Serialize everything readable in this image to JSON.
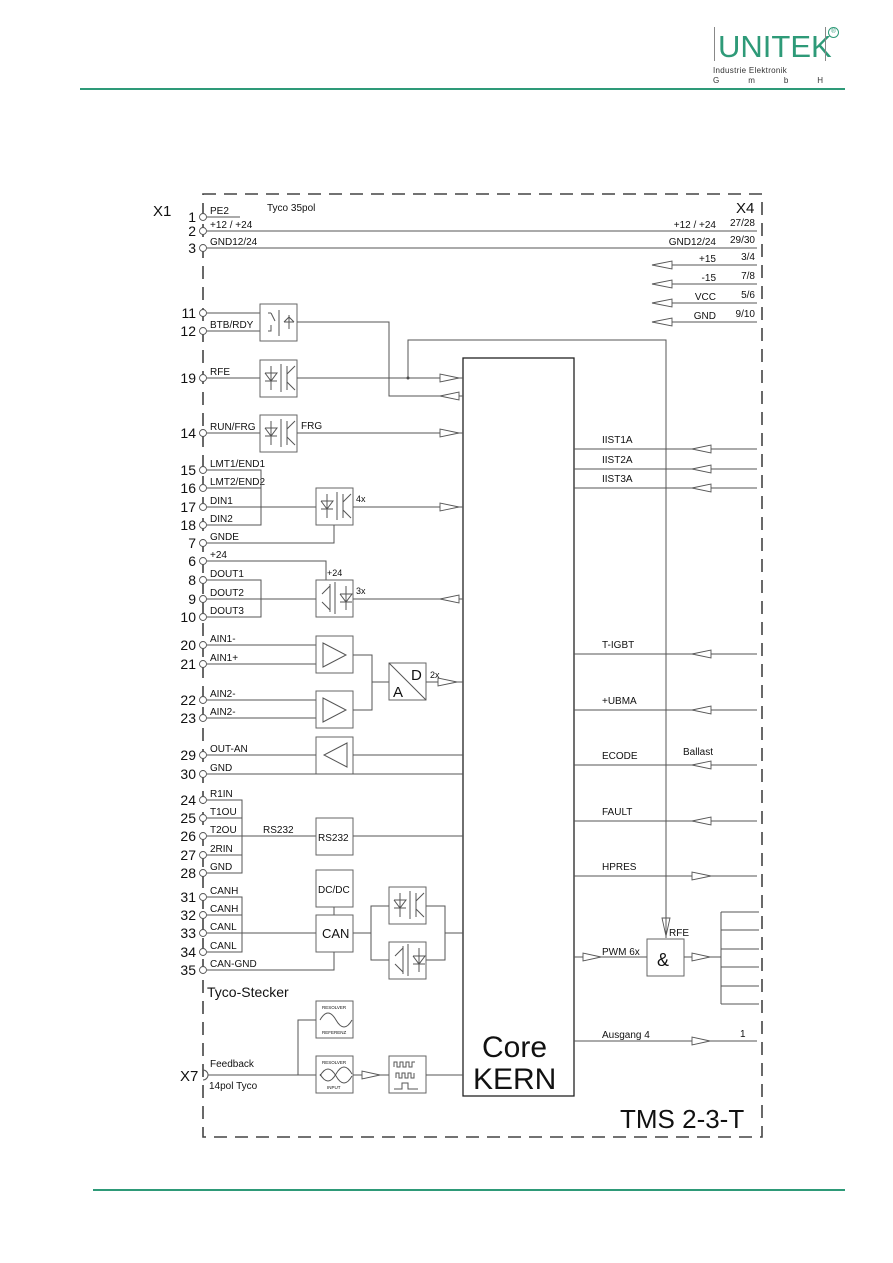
{
  "header": {
    "logo": {
      "brand": "UNITEK",
      "subtitle": "Industrie Elektronik",
      "gmbh": [
        "G",
        "m",
        "b",
        "H"
      ],
      "registered_mark": "®"
    }
  },
  "colors": {
    "accent": "#2e9a78",
    "line": "#555555"
  },
  "diagram": {
    "title": "TMS 2-3-T",
    "core_label_line1": "Core",
    "core_label_line2": "KERN",
    "x1_label": "X1",
    "x4_label": "X4",
    "x7_label": "X7",
    "connector_note": "Tyco 35pol",
    "tyco_stecker": "Tyco-Stecker",
    "feedback_label": "Feedback",
    "feedback_connector": "14pol Tyco",
    "x1_pins": [
      {
        "pin": "1",
        "signal": "PE2"
      },
      {
        "pin": "2",
        "signal": "+12 / +24"
      },
      {
        "pin": "3",
        "signal": "GND12/24"
      },
      {
        "pin": "11",
        "signal": ""
      },
      {
        "pin": "12",
        "signal": "BTB/RDY"
      },
      {
        "pin": "19",
        "signal": "RFE"
      },
      {
        "pin": "14",
        "signal": "RUN/FRG"
      },
      {
        "pin": "15",
        "signal": "LMT1/END1"
      },
      {
        "pin": "16",
        "signal": "LMT2/END2"
      },
      {
        "pin": "17",
        "signal": "DIN1"
      },
      {
        "pin": "18",
        "signal": "DIN2"
      },
      {
        "pin": "7",
        "signal": "GNDE"
      },
      {
        "pin": "6",
        "signal": "+24"
      },
      {
        "pin": "8",
        "signal": "DOUT1"
      },
      {
        "pin": "9",
        "signal": "DOUT2"
      },
      {
        "pin": "10",
        "signal": "DOUT3"
      },
      {
        "pin": "20",
        "signal": "AIN1-"
      },
      {
        "pin": "21",
        "signal": "AIN1+"
      },
      {
        "pin": "22",
        "signal": "AIN2-"
      },
      {
        "pin": "23",
        "signal": "AIN2-"
      },
      {
        "pin": "29",
        "signal": "OUT-AN"
      },
      {
        "pin": "30",
        "signal": "GND"
      },
      {
        "pin": "24",
        "signal": "R1IN"
      },
      {
        "pin": "25",
        "signal": "T1OU"
      },
      {
        "pin": "26",
        "signal": "T2OU"
      },
      {
        "pin": "27",
        "signal": "2RIN"
      },
      {
        "pin": "28",
        "signal": "GND"
      },
      {
        "pin": "31",
        "signal": "CANH"
      },
      {
        "pin": "32",
        "signal": "CANH"
      },
      {
        "pin": "33",
        "signal": "CANL"
      },
      {
        "pin": "34",
        "signal": "CANL"
      },
      {
        "pin": "35",
        "signal": "CAN-GND"
      }
    ],
    "x4_pins": [
      {
        "signal": "+12 / +24",
        "pins": "27/28"
      },
      {
        "signal": "GND12/24",
        "pins": "29/30"
      },
      {
        "signal": "+15",
        "pins": "3/4"
      },
      {
        "signal": "-15",
        "pins": "7/8"
      },
      {
        "signal": "VCC",
        "pins": "5/6"
      },
      {
        "signal": "GND",
        "pins": "9/10"
      }
    ],
    "labels": {
      "frg": "FRG",
      "din_mult": "4x",
      "plus24": "+24",
      "dout_mult": "3x",
      "adc_mult": "2x",
      "adc_a": "A",
      "adc_d": "D",
      "rs232_line": "RS232",
      "rs232_box": "RS232",
      "dcdc_box": "DC/DC",
      "can_box": "CAN",
      "resolver_top": "RESOLVER",
      "resolver_ref": "REFERENZ",
      "resolver_in": "INPUT",
      "and_gate": "&",
      "rfe": "RFE",
      "pwm": "PWM 6x",
      "ballast": "Ballast",
      "ausgang": "Ausgang 4",
      "ausgang_pin": "1"
    },
    "right_signals": [
      {
        "name": "IIST1A",
        "direction": "in"
      },
      {
        "name": "IIST2A",
        "direction": "in"
      },
      {
        "name": "IIST3A",
        "direction": "in"
      },
      {
        "name": "T-IGBT",
        "direction": "in"
      },
      {
        "name": "+UBMA",
        "direction": "in"
      },
      {
        "name": "ECODE",
        "direction": "in"
      },
      {
        "name": "FAULT",
        "direction": "in"
      },
      {
        "name": "HPRES",
        "direction": "out"
      }
    ]
  }
}
